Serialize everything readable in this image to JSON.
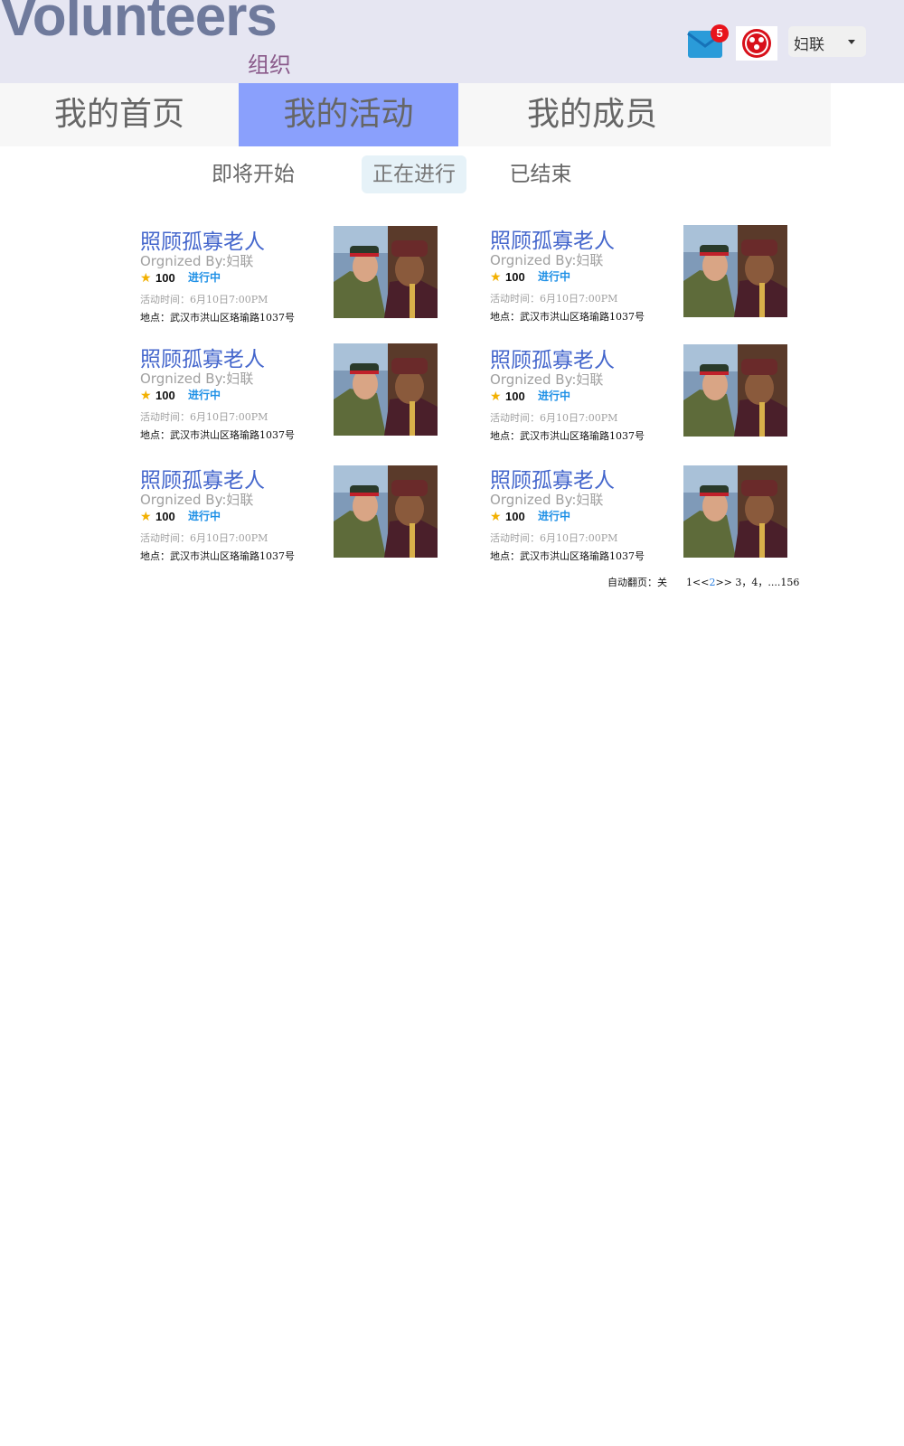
{
  "header": {
    "brand": "Volunteers",
    "subtitle": "组织",
    "mail_count": "5",
    "user_name": "妇联"
  },
  "main_nav": [
    {
      "label": "我的首页",
      "active": false
    },
    {
      "label": "我的活动",
      "active": true
    },
    {
      "label": "我的成员",
      "active": false
    }
  ],
  "sub_nav": [
    {
      "label": "即将开始",
      "active": false
    },
    {
      "label": "正在进行",
      "active": true
    },
    {
      "label": "已结束",
      "active": false
    }
  ],
  "activities": [
    {
      "title": "照顾孤寡老人",
      "org": "Orgnized By:妇联",
      "score": "100",
      "status": "进行中",
      "time": "活动时间：6月10日7:00PM",
      "location": "地点：武汉市洪山区珞瑜路1037号"
    },
    {
      "title": "照顾孤寡老人",
      "org": "Orgnized By:妇联",
      "score": "100",
      "status": "进行中",
      "time": "活动时间：6月10日7:00PM",
      "location": "地点：武汉市洪山区珞瑜路1037号"
    },
    {
      "title": "照顾孤寡老人",
      "org": "Orgnized By:妇联",
      "score": "100",
      "status": "进行中",
      "time": "活动时间：6月10日7:00PM",
      "location": "地点：武汉市洪山区珞瑜路1037号"
    },
    {
      "title": "照顾孤寡老人",
      "org": "Orgnized By:妇联",
      "score": "100",
      "status": "进行中",
      "time": "活动时间：6月10日7:00PM",
      "location": "地点：武汉市洪山区珞瑜路1037号"
    },
    {
      "title": "照顾孤寡老人",
      "org": "Orgnized By:妇联",
      "score": "100",
      "status": "进行中",
      "time": "活动时间：6月10日7:00PM",
      "location": "地点：武汉市洪山区珞瑜路1037号"
    },
    {
      "title": "照顾孤寡老人",
      "org": "Orgnized By:妇联",
      "score": "100",
      "status": "进行中",
      "time": "活动时间：6月10日7:00PM",
      "location": "地点：武汉市洪山区珞瑜路1037号"
    }
  ],
  "pagination": {
    "auto_label": "自动翻页：关",
    "prefix": "1<<",
    "current": "2",
    "suffix": ">> 3，4，....156"
  },
  "icons": {
    "mail": "mail-icon",
    "org_logo": "women-federation-logo",
    "star": "star-icon",
    "caret": "chevron-down-icon"
  },
  "colors": {
    "header_bg": "#e6e6f2",
    "brand": "#6f7a9c",
    "active_tab": "#8aa0fc",
    "title_blue": "#4466cc",
    "status_blue": "#1e90e6",
    "badge_red": "#e8141c",
    "star_gold": "#f2b000"
  }
}
